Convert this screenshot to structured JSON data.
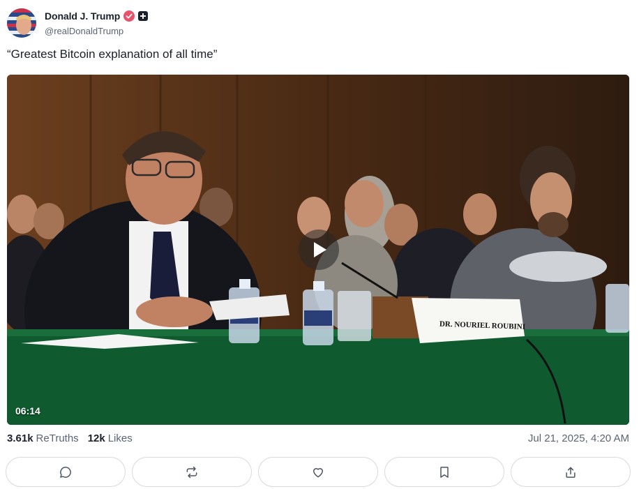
{
  "author": {
    "display_name": "Donald J. Trump",
    "handle": "@realDonaldTrump",
    "verified_color": "#e8526a"
  },
  "post": {
    "text": "“Greatest Bitcoin explanation of all time”"
  },
  "video": {
    "duration": "06:14",
    "nameplate": "Dr. Nouriel Roubini"
  },
  "stats": {
    "retruths_count": "3.61k",
    "retruths_label": "ReTruths",
    "likes_count": "12k",
    "likes_label": "Likes",
    "timestamp": "Jul 21, 2025, 4:20 AM"
  },
  "actions": [
    {
      "name": "reply",
      "icon": "comment-icon"
    },
    {
      "name": "retruth",
      "icon": "repost-icon"
    },
    {
      "name": "like",
      "icon": "heart-icon"
    },
    {
      "name": "bookmark",
      "icon": "bookmark-icon"
    },
    {
      "name": "share",
      "icon": "share-icon"
    }
  ]
}
